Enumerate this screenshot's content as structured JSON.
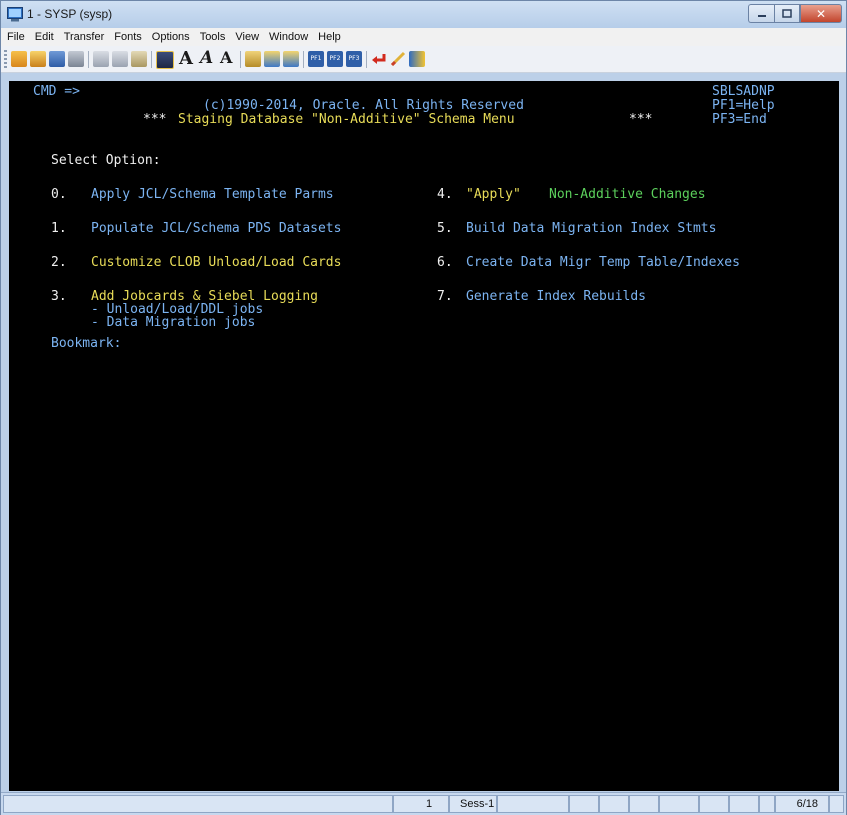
{
  "window": {
    "title": "1 - SYSP (sysp)",
    "close_glyph": "✕"
  },
  "menu": [
    "File",
    "Edit",
    "Transfer",
    "Fonts",
    "Options",
    "Tools",
    "View",
    "Window",
    "Help"
  ],
  "toolbar": {
    "font_large": "A",
    "font_medium": "A",
    "font_small": "A",
    "pf1": "PF1",
    "pf2": "PF2",
    "pf3": "PF3"
  },
  "terminal": {
    "cmd": "CMD =>",
    "program": "SBLSADNP",
    "copyright": "(c)1990-2014, Oracle. All Rights Reserved",
    "pf1": "PF1=Help",
    "stars": "***",
    "menu_title": "Staging Database \"Non-Additive\" Schema Menu",
    "pf3": "PF3=End",
    "select_option": "Select Option:",
    "options": [
      {
        "num": "0.",
        "label": "Apply JCL/Schema Template Parms"
      },
      {
        "num": "1.",
        "label": "Populate JCL/Schema PDS Datasets"
      },
      {
        "num": "2.",
        "label": "Customize CLOB Unload/Load Cards"
      },
      {
        "num": "3.",
        "label": "Add Jobcards & Siebel Logging"
      },
      {
        "num": "4.",
        "label_quoted": "\"Apply\"",
        "label": "Non-Additive Changes"
      },
      {
        "num": "5.",
        "label": "Build Data Migration Index Stmts"
      },
      {
        "num": "6.",
        "label": "Create Data Migr Temp Table/Indexes"
      },
      {
        "num": "7.",
        "label": "Generate Index Rebuilds"
      }
    ],
    "sub_items": [
      "- Unload/Load/DDL jobs",
      "- Data Migration jobs"
    ],
    "bookmark": "Bookmark:"
  },
  "status": {
    "session_num": "1",
    "session": "Sess-1",
    "position": "6/18"
  },
  "colors": {
    "text_blue": "#7cb4f2",
    "text_yellow": "#e8dc58",
    "text_green": "#5cd05c",
    "text_white": "#f0f0f0",
    "background": "#000000"
  }
}
